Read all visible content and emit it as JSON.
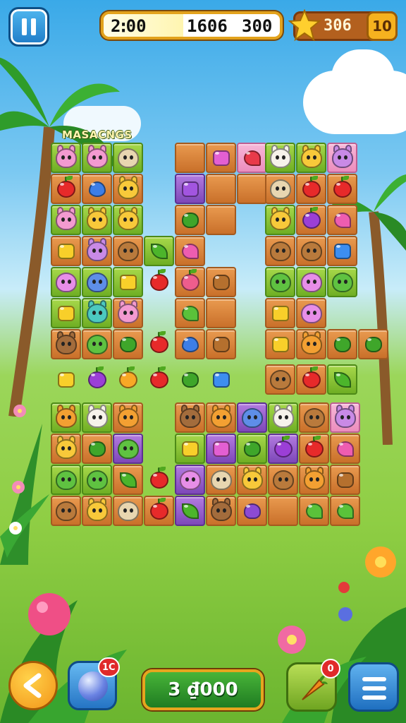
{
  "hud": {
    "score_left": "2ꓽ00",
    "score_mid": "1606",
    "score_right": "300",
    "score_progress": 0.45,
    "star_count": "306",
    "level": "10",
    "icons": [
      "pause-icon",
      "star-icon"
    ]
  },
  "title": "MASACNGS",
  "bottom": {
    "orb_badge": "1C",
    "coins": "3 ₫000",
    "carrot_badge": "0",
    "icons": [
      "back-icon",
      "orb-icon",
      "carrot-icon",
      "menu-icon"
    ]
  },
  "colors": {
    "tile_orange": "#e99a4f",
    "tile_green": "#a7d84a",
    "tile_purple": "#b37be0",
    "accent_gold": "#e2a21c",
    "panel_green": "#2e9a2c"
  },
  "board": {
    "pieces": [
      "pink-bunny",
      "pink-bunny",
      "tan-bear",
      "strawberry",
      "blue-drop",
      "yellow-cat",
      "pink-bunny",
      "yellow-cat",
      "yellow-cat",
      "yellow-gem",
      "purple-monster",
      "brown-monkey",
      "green-leaf",
      "pink-ghost",
      "blue-ghost",
      "yellow-star",
      "strawberry",
      "yellow-gem",
      "teal-cat",
      "pink-bunny",
      "brown-bear",
      "green-frog",
      "green-bush",
      "strawberry",
      "yellow-gem",
      "purple-plum",
      "orange-fruit",
      "strawberry",
      "green-bush",
      "blue-gem"
    ]
  }
}
